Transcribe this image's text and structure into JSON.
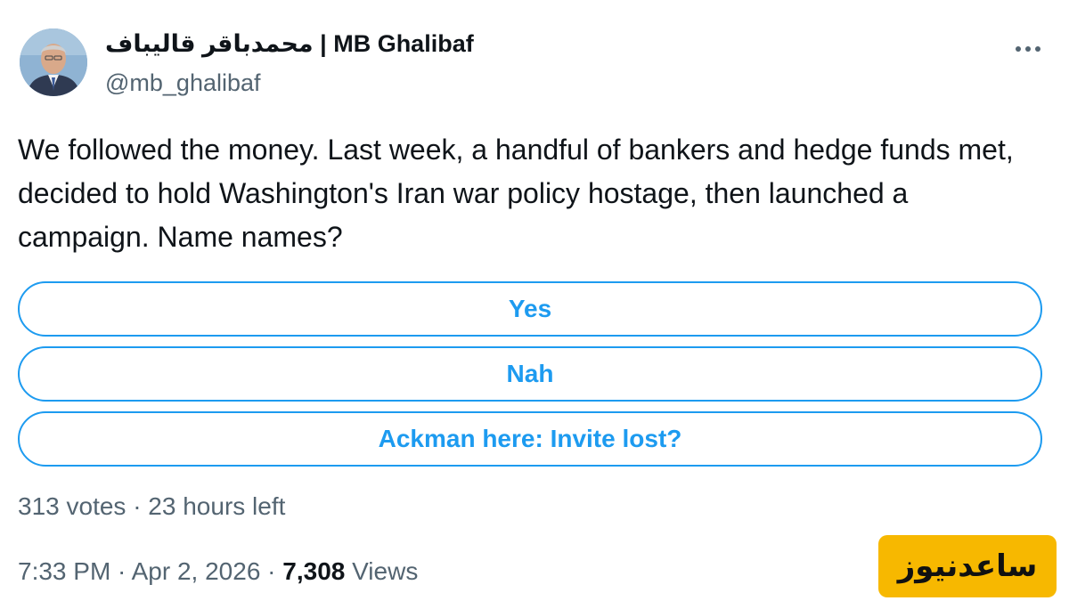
{
  "tweet": {
    "author": {
      "display_name": "محمدباقر قالیباف | MB Ghalibaf",
      "handle": "@mb_ghalibaf",
      "avatar_icon": "profile-photo"
    },
    "more_icon": "more-dots-icon",
    "text": "We followed the money. Last week, a handful of bankers and hedge funds met, decided to hold Washington's Iran war policy hostage, then launched a campaign. Name names?",
    "poll": {
      "options": [
        "Yes",
        "Nah",
        "Ackman here: Invite lost?"
      ],
      "meta": "313 votes · 23 hours left",
      "accent_color": "#1d9bf0"
    },
    "timestamp": "7:33 PM · Apr 2, 2026",
    "separator": " · ",
    "views_count": "7,308",
    "views_label": " Views"
  },
  "watermark": {
    "text": "ساعدنیوز",
    "color": "#f7b800"
  }
}
